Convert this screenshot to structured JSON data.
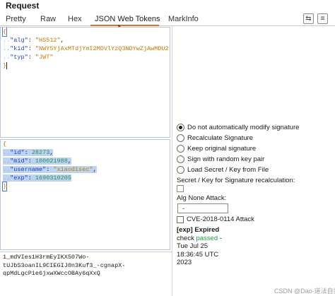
{
  "panel": {
    "title": "Request"
  },
  "tabs": [
    {
      "label": "Pretty"
    },
    {
      "label": "Raw"
    },
    {
      "label": "Hex"
    },
    {
      "label": "JSON Web Tokens"
    },
    {
      "label": "MarkInfo"
    }
  ],
  "toolbar": {
    "icon1": "wrap-lines-icon",
    "icon2": "menu-icon"
  },
  "header_json": {
    "open": "{",
    "close": "}",
    "lines": [
      {
        "dots": "..",
        "key": "\"alg\"",
        "colon": ": ",
        "value": "\"HS512\"",
        "tail": ","
      },
      {
        "dots": "..",
        "key": "\"kid\"",
        "colon": ": ",
        "value": "\"NWY5YjAxMTdjYmI2MDVlYzQ3NDYwZjAwMDU2",
        "tail": ""
      },
      {
        "dots": "..",
        "key": "\"typ\"",
        "colon": ": ",
        "value": "\"JWT\"",
        "tail": ""
      }
    ]
  },
  "payload_json": {
    "open": "{",
    "close": "}",
    "lines": [
      {
        "dots": "..",
        "key": "\"id\"",
        "colon": ": ",
        "value": "28273",
        "tail": ","
      },
      {
        "dots": "..",
        "key": "\"mid\"",
        "colon": ": ",
        "value": "100021988",
        "tail": ","
      },
      {
        "dots": "..",
        "key": "\"username\"",
        "colon": ": ",
        "value": "\"xiaodisec\"",
        "tail": ","
      },
      {
        "dots": "..",
        "key": "\"exp\"",
        "colon": ": ",
        "value": "1690310205",
        "tail": ""
      }
    ]
  },
  "token_text": [
    "1_mdVIes1H3rmEyIKX507Wo-",
    "tUJbS3oanIL9CIEGIJ0n3Kuf3_-cgnapX-",
    "qpMdLgcPie6jxwXWccOBAy6qXxQ"
  ],
  "options": [
    {
      "label": "Do not automatically modify signature",
      "selected": true
    },
    {
      "label": "Recalculate Signature",
      "selected": false
    },
    {
      "label": "Keep original signature",
      "selected": false
    },
    {
      "label": "Sign with random key pair",
      "selected": false
    },
    {
      "label": "Load Secret / Key from File",
      "selected": false
    }
  ],
  "secret_label": "Secret / Key for Signature recalculation:",
  "alg_none_label": "Alg None Attack:",
  "alg_none_value": "-",
  "cve_label": "CVE-2018-0114 Attack",
  "status": {
    "expired": "[exp] Expired",
    "check_prefix": "check ",
    "check_passed": "passed",
    "check_suffix": " -",
    "date_line1": "Tue Jul 25",
    "date_line2": "18:36:45 UTC",
    "date_line3": "2023"
  },
  "watermark": "CSDN @Dao-道法自然"
}
